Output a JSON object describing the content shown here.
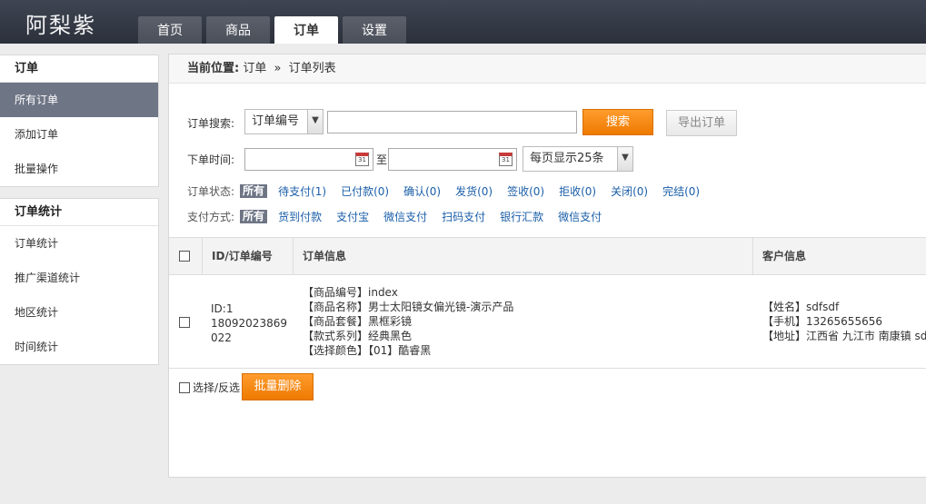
{
  "header": {
    "logo": "阿梨紫",
    "tabs": [
      {
        "label": "首页",
        "active": false
      },
      {
        "label": "商品",
        "active": false
      },
      {
        "label": "订单",
        "active": true
      },
      {
        "label": "设置",
        "active": false
      }
    ]
  },
  "sidebar": {
    "groups": [
      {
        "title": "订单",
        "items": [
          "所有订单",
          "添加订单",
          "批量操作"
        ]
      },
      {
        "title": "订单统计",
        "items": [
          "订单统计",
          "推广渠道统计",
          "地区统计",
          "时间统计"
        ]
      }
    ],
    "active_item": "所有订单"
  },
  "breadcrumb": {
    "prefix": "当前位置:",
    "parent": "订单",
    "sep": "»",
    "current": "订单列表"
  },
  "search": {
    "label": "订单搜索:",
    "field_select": "订单编号",
    "keyword_value": "",
    "search_button": "搜索",
    "export_button": "导出订单"
  },
  "time": {
    "label": "下单时间:",
    "start_value": "",
    "to": "至",
    "end_value": "",
    "page_size": "每页显示25条"
  },
  "status_filter": {
    "label": "订单状态:",
    "all": "所有",
    "options": [
      "待支付(1)",
      "已付款(0)",
      "确认(0)",
      "发货(0)",
      "签收(0)",
      "拒收(0)",
      "关闭(0)",
      "完结(0)"
    ]
  },
  "pay_filter": {
    "label": "支付方式:",
    "all": "所有",
    "options": [
      "货到付款",
      "支付宝",
      "微信支付",
      "扫码支付",
      "银行汇款",
      "微信支付"
    ]
  },
  "table": {
    "headers": [
      "ID/订单编号",
      "订单信息",
      "客户信息"
    ],
    "rows": [
      {
        "id_line1": "ID:1",
        "id_line2": "18092023869",
        "id_line3": "022",
        "info": [
          "【商品编号】index",
          "【商品名称】男士太阳镜女偏光镜-演示产品",
          "【商品套餐】黑框彩镜",
          "【款式系列】经典黑色",
          "【选择颜色】【01】酷睿黑"
        ],
        "customer": [
          "【姓名】sdfsdf",
          "【手机】13265655656",
          "【地址】江西省 九江市 南康镇 sdf"
        ]
      }
    ]
  },
  "bulk": {
    "select_toggle": "选择/反选",
    "delete_button": "批量删除"
  },
  "colors": {
    "accent_orange": "#ee7a00",
    "header_dark": "#2b303b",
    "sidebar_active": "#6e7585",
    "link_blue": "#1a5ea8"
  }
}
